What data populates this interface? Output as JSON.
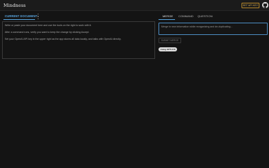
{
  "app": {
    "title": "Mindness"
  },
  "header": {
    "api_key_button": "SET API KEY",
    "github_icon": "github-icon"
  },
  "left": {
    "tab_label": "CURRENT DOCUMENT",
    "menu_icon": "more-vertical-icon",
    "document_lines": [
      "Write or paste your document here and use the tools on the right to work with it.",
      "After a command runs, verify you want to keep the change by clicking Accept.",
      "Set your OpenAI API key in the upper right as the app stores all data locally, and talks with OpenAI directly."
    ]
  },
  "right": {
    "tabs": [
      {
        "label": "MERGE",
        "active": true
      },
      {
        "label": "COMMAND",
        "active": false
      },
      {
        "label": "QUESTION",
        "active": false
      }
    ],
    "merge_placeholder": "Merge in new information while reorganizing and de-duplicating...",
    "submit_button": "SUBMIT MERGE",
    "model_badge": "Using GPT-3.5t"
  },
  "colors": {
    "accent": "#59a6e0",
    "api_button": "#b8892a",
    "background": "#141414"
  }
}
